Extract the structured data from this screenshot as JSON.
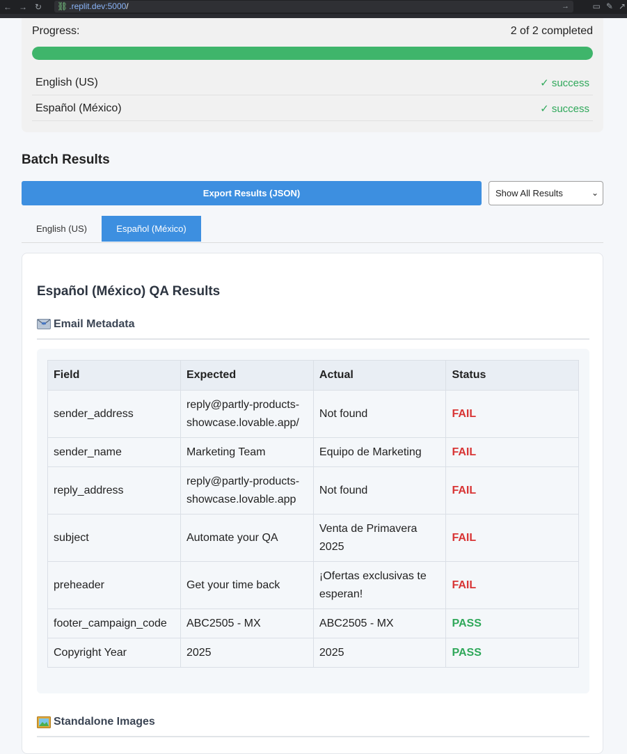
{
  "browser": {
    "url_host": ".replit.dev:5000",
    "url_path": "/"
  },
  "progress": {
    "label": "Progress:",
    "count_text": "2 of 2 completed",
    "fraction": 1.0,
    "languages": [
      {
        "name": "English (US)",
        "status": "✓ success"
      },
      {
        "name": "Español (México)",
        "status": "✓ success"
      }
    ]
  },
  "batch": {
    "title": "Batch Results",
    "export_label": "Export Results (JSON)",
    "filter_selected": "Show All Results",
    "tabs": [
      {
        "label": "English (US)",
        "active": false
      },
      {
        "label": "Español (México)",
        "active": true
      }
    ]
  },
  "results": {
    "title": "Español (México) QA Results",
    "email_metadata_heading": "Email Metadata",
    "standalone_images_heading": "Standalone Images",
    "columns": [
      "Field",
      "Expected",
      "Actual",
      "Status"
    ],
    "rows": [
      {
        "field": "sender_address",
        "expected": "reply@partly-products-showcase.lovable.app/",
        "actual": "Not found",
        "status": "FAIL"
      },
      {
        "field": "sender_name",
        "expected": "Marketing Team",
        "actual": "Equipo de Marketing",
        "status": "FAIL"
      },
      {
        "field": "reply_address",
        "expected": "reply@partly-products-showcase.lovable.app",
        "actual": "Not found",
        "status": "FAIL"
      },
      {
        "field": "subject",
        "expected": "Automate your QA",
        "actual": "Venta de Primavera 2025",
        "status": "FAIL"
      },
      {
        "field": "preheader",
        "expected": "Get your time back",
        "actual": "¡Ofertas exclusivas te esperan!",
        "status": "FAIL"
      },
      {
        "field": "footer_campaign_code",
        "expected": "ABC2505 - MX",
        "actual": "ABC2505 - MX",
        "status": "PASS"
      },
      {
        "field": "Copyright Year",
        "expected": "2025",
        "actual": "2025",
        "status": "PASS"
      }
    ]
  },
  "colors": {
    "accent": "#3d8fe0",
    "success": "#2fa85a",
    "fail": "#d83434"
  }
}
